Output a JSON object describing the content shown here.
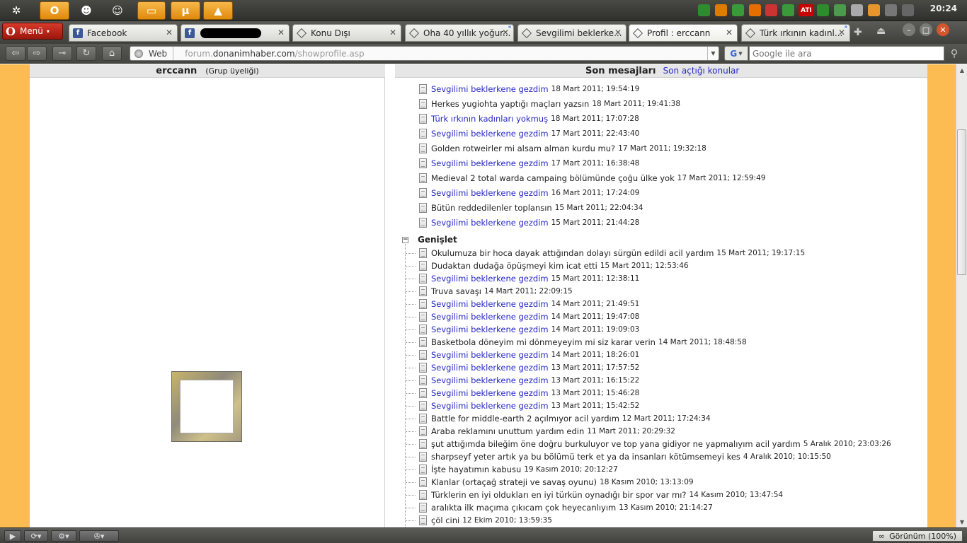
{
  "clock": "20:24",
  "panel": {
    "launchers": [
      {
        "icon": "ubuntu-logo-icon",
        "glyph": "✲",
        "active": false
      },
      {
        "icon": "opera-icon",
        "glyph": "O",
        "active": true
      },
      {
        "icon": "messenger-icon",
        "glyph": "☻",
        "active": false
      },
      {
        "icon": "smiley-app-icon",
        "glyph": "☺",
        "active": false
      },
      {
        "icon": "file-manager-icon",
        "glyph": "▭",
        "active": true
      },
      {
        "icon": "utorrent-icon",
        "glyph": "µ",
        "active": true
      },
      {
        "icon": "vlc-icon",
        "glyph": "▲",
        "active": true
      }
    ],
    "tray": [
      {
        "icon": "recycle-icon",
        "color": "#2e8b2e"
      },
      {
        "icon": "pause-icon",
        "color": "#e07b00"
      },
      {
        "icon": "utorrent-tray-icon",
        "color": "#3a9a3a"
      },
      {
        "icon": "vlc-tray-icon",
        "color": "#e46f00"
      },
      {
        "icon": "volume-icon",
        "color": "#c33"
      },
      {
        "icon": "user-icon",
        "color": "#3a9a3a"
      },
      {
        "icon": "ati-icon",
        "color": "#c00",
        "text": "ATI"
      },
      {
        "icon": "nvidia-icon",
        "color": "#2e8b2e"
      },
      {
        "icon": "battery-icon",
        "color": "#4c9a4c"
      },
      {
        "icon": "disc-icon",
        "color": "#aaa"
      },
      {
        "icon": "update-icon",
        "color": "#e8952c"
      },
      {
        "icon": "usb-icon",
        "color": "#777"
      },
      {
        "icon": "signal-icon",
        "color": "#666"
      }
    ]
  },
  "browser": {
    "menu_label": "Menü",
    "tabs": [
      {
        "label": "Facebook",
        "icon": "facebook",
        "active": false
      },
      {
        "label": "",
        "icon": "facebook",
        "active": false,
        "redacted": true
      },
      {
        "label": "Konu Dışı",
        "icon": "donanimhaber",
        "active": false
      },
      {
        "label": "Oha 40 yıllık yoğur...",
        "icon": "donanimhaber",
        "active": false,
        "dot": true
      },
      {
        "label": "Sevgilimi beklerke...",
        "icon": "donanimhaber",
        "active": false
      },
      {
        "label": "Profil : erccann",
        "icon": "donanimhaber",
        "active": true
      },
      {
        "label": "Türk ırkının kadınl...",
        "icon": "donanimhaber",
        "active": false,
        "dot": true
      }
    ],
    "address": {
      "web_label": "Web",
      "url_prefix": "forum.",
      "url_domain": "donanimhaber.com",
      "url_path": "/showprofile.asp"
    },
    "search": {
      "engine": "G",
      "placeholder": "Google ile ara"
    },
    "status": {
      "zoom_label": "Görünüm (100%)"
    }
  },
  "profile": {
    "username": "erccann",
    "group": "(Grup üyeliği)"
  },
  "messages": {
    "heading": "Son mesajları",
    "opened_topics_link": "Son açtığı konular",
    "expand_label": "Genişlet",
    "top_posts": [
      {
        "title": "Sevgilimi beklerkene gezdim",
        "date": "18 Mart 2011; 19:54:19",
        "link": true
      },
      {
        "title": "Herkes yugiohta yaptığı maçları yazsın",
        "date": "18 Mart 2011; 19:41:38",
        "link": false
      },
      {
        "title": "Türk ırkının kadınları yokmuş",
        "date": "18 Mart 2011; 17:07:28",
        "link": true
      },
      {
        "title": "Sevgilimi beklerkene gezdim",
        "date": "17 Mart 2011; 22:43:40",
        "link": true
      },
      {
        "title": "Golden rotweirler mi alsam alman kurdu mu?",
        "date": "17 Mart 2011; 19:32:18",
        "link": false
      },
      {
        "title": "Sevgilimi beklerkene gezdim",
        "date": "17 Mart 2011; 16:38:48",
        "link": true
      },
      {
        "title": "Medieval 2 total warda campaing bölümünde çoğu ülke yok",
        "date": "17 Mart 2011; 12:59:49",
        "link": false
      },
      {
        "title": "Sevgilimi beklerkene gezdim",
        "date": "16 Mart 2011; 17:24:09",
        "link": true
      },
      {
        "title": "Bütün reddedilenler toplansın",
        "date": "15 Mart 2011; 22:04:34",
        "link": false
      },
      {
        "title": "Sevgilimi beklerkene gezdim",
        "date": "15 Mart 2011; 21:44:28",
        "link": true
      }
    ],
    "expanded_posts": [
      {
        "title": "Okulumuza bir hoca dayak attığından dolayı sürgün edildi acil yardım",
        "date": "15 Mart 2011; 19:17:15",
        "link": false
      },
      {
        "title": "Dudaktan dudağa öpüşmeyi kim icat etti",
        "date": "15 Mart 2011; 12:53:46",
        "link": false
      },
      {
        "title": "Sevgilimi beklerkene gezdim",
        "date": "15 Mart 2011; 12:38:11",
        "link": true
      },
      {
        "title": "Truva savaşı",
        "date": "14 Mart 2011; 22:09:15",
        "link": false
      },
      {
        "title": "Sevgilimi beklerkene gezdim",
        "date": "14 Mart 2011; 21:49:51",
        "link": true
      },
      {
        "title": "Sevgilimi beklerkene gezdim",
        "date": "14 Mart 2011; 19:47:08",
        "link": true
      },
      {
        "title": "Sevgilimi beklerkene gezdim",
        "date": "14 Mart 2011; 19:09:03",
        "link": true
      },
      {
        "title": "Basketbola döneyim mi dönmeyeyim mi siz karar verin",
        "date": "14 Mart 2011; 18:48:58",
        "link": false
      },
      {
        "title": "Sevgilimi beklerkene gezdim",
        "date": "14 Mart 2011; 18:26:01",
        "link": true
      },
      {
        "title": "Sevgilimi beklerkene gezdim",
        "date": "13 Mart 2011; 17:57:52",
        "link": true
      },
      {
        "title": "Sevgilimi beklerkene gezdim",
        "date": "13 Mart 2011; 16:15:22",
        "link": true
      },
      {
        "title": "Sevgilimi beklerkene gezdim",
        "date": "13 Mart 2011; 15:46:28",
        "link": true
      },
      {
        "title": "Sevgilimi beklerkene gezdim",
        "date": "13 Mart 2011; 15:42:52",
        "link": true
      },
      {
        "title": "Battle for middle-earth 2 açılmıyor acil yardım",
        "date": "12 Mart 2011; 17:24:34",
        "link": false
      },
      {
        "title": "Araba reklamını unuttum yardım edin",
        "date": "11 Mart 2011; 20:29:32",
        "link": false
      },
      {
        "title": "şut attığımda bileğim öne doğru burkuluyor ve top yana gidiyor ne yapmalıyım acil yardım",
        "date": "5 Aralık 2010; 23:03:26",
        "link": false
      },
      {
        "title": "sharpseyf yeter artık ya bu bölümü terk et ya da insanları kötümsemeyi kes",
        "date": "4 Aralık 2010; 10:15:50",
        "link": false
      },
      {
        "title": "İşte hayatımın kabusu",
        "date": "19 Kasım 2010; 20:12:27",
        "link": false
      },
      {
        "title": "Klanlar (ortaçağ strateji ve savaş oyunu)",
        "date": "18 Kasım 2010; 13:13:09",
        "link": false
      },
      {
        "title": "Türklerin en iyi oldukları en iyi türkün oynadığı bir spor var mı?",
        "date": "14 Kasım 2010; 13:47:54",
        "link": false
      },
      {
        "title": "aralıkta ilk maçıma çıkıcam çok heyecanlıyım",
        "date": "13 Kasım 2010; 21:14:27",
        "link": false
      },
      {
        "title": "çöl cini",
        "date": "12 Ekim 2010; 13:59:35",
        "link": false
      }
    ]
  }
}
